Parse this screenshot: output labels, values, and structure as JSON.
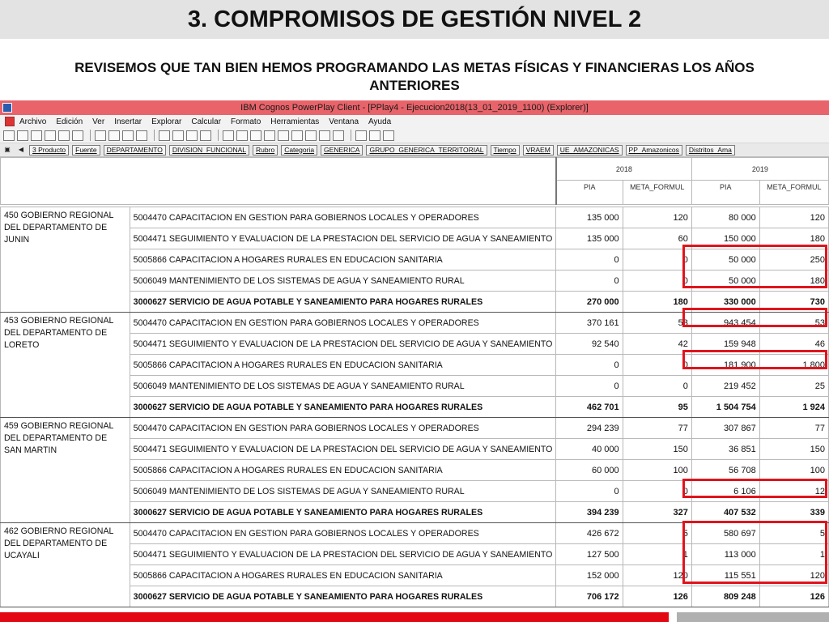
{
  "slide": {
    "title": "3. COMPROMISOS DE GESTIÓN NIVEL 2",
    "subtitle_line1": "REVISEMOS QUE TAN BIEN HEMOS PROGRAMANDO LAS METAS FÍSICAS Y FINANCIERAS LOS AÑOS",
    "subtitle_line2": "ANTERIORES"
  },
  "window": {
    "title": "IBM Cognos PowerPlay Client - [PPlay4 - Ejecucion2018(13_01_2019_1100) (Explorer)]",
    "menu": [
      "Archivo",
      "Edición",
      "Ver",
      "Insertar",
      "Explorar",
      "Calcular",
      "Formato",
      "Herramientas",
      "Ventana",
      "Ayuda"
    ],
    "dimensions": [
      "3 Producto",
      "Fuente",
      "DEPARTAMENTO",
      "DIVISION_FUNCIONAL",
      "Rubro",
      "Categoria",
      "GENERICA",
      "GRUPO_GENERICA_TERRITORIAL",
      "Tiempo",
      "VRAEM",
      "UE_AMAZONICAS",
      "PP_Amazonicos",
      "Distritos_Ama"
    ]
  },
  "table": {
    "years": [
      "2018",
      "2019"
    ],
    "columns": [
      "PIA",
      "META_FORMUL",
      "PIA",
      "META_FORMUL"
    ],
    "groups": [
      {
        "region": "450 GOBIERNO REGIONAL DEL DEPARTAMENTO DE JUNIN",
        "rows": [
          {
            "label": "5004470 CAPACITACION EN GESTION PARA GOBIERNOS LOCALES Y OPERADORES",
            "v": [
              "135 000",
              "120",
              "80 000",
              "120"
            ]
          },
          {
            "label": "5004471 SEGUIMIENTO Y EVALUACION DE LA PRESTACION DEL SERVICIO DE AGUA Y SANEAMIENTO",
            "v": [
              "135 000",
              "60",
              "150 000",
              "180"
            ]
          },
          {
            "label": "5005866 CAPACITACION A HOGARES RURALES EN EDUCACION SANITARIA",
            "v": [
              "0",
              "0",
              "50 000",
              "250"
            ]
          },
          {
            "label": "5006049 MANTENIMIENTO DE LOS SISTEMAS DE AGUA Y SANEAMIENTO RURAL",
            "v": [
              "0",
              "0",
              "50 000",
              "180"
            ]
          }
        ],
        "total": {
          "label": "3000627 SERVICIO DE AGUA POTABLE Y SANEAMIENTO PARA HOGARES RURALES",
          "v": [
            "270 000",
            "180",
            "330 000",
            "730"
          ]
        }
      },
      {
        "region": "453 GOBIERNO REGIONAL DEL DEPARTAMENTO DE LORETO",
        "rows": [
          {
            "label": "5004470 CAPACITACION EN GESTION PARA GOBIERNOS LOCALES Y OPERADORES",
            "v": [
              "370 161",
              "53",
              "943 454",
              "53"
            ]
          },
          {
            "label": "5004471 SEGUIMIENTO Y EVALUACION DE LA PRESTACION DEL SERVICIO DE AGUA Y SANEAMIENTO",
            "v": [
              "92 540",
              "42",
              "159 948",
              "46"
            ]
          },
          {
            "label": "5005866 CAPACITACION A HOGARES RURALES EN EDUCACION SANITARIA",
            "v": [
              "0",
              "0",
              "181 900",
              "1 800"
            ]
          },
          {
            "label": "5006049 MANTENIMIENTO DE LOS SISTEMAS DE AGUA Y SANEAMIENTO RURAL",
            "v": [
              "0",
              "0",
              "219 452",
              "25"
            ]
          }
        ],
        "total": {
          "label": "3000627 SERVICIO DE AGUA POTABLE Y SANEAMIENTO PARA HOGARES RURALES",
          "v": [
            "462 701",
            "95",
            "1 504 754",
            "1 924"
          ]
        }
      },
      {
        "region": "459 GOBIERNO REGIONAL DEL DEPARTAMENTO DE SAN MARTIN",
        "rows": [
          {
            "label": "5004470 CAPACITACION EN GESTION PARA GOBIERNOS LOCALES Y OPERADORES",
            "v": [
              "294 239",
              "77",
              "307 867",
              "77"
            ]
          },
          {
            "label": "5004471 SEGUIMIENTO Y EVALUACION DE LA PRESTACION DEL SERVICIO DE AGUA Y SANEAMIENTO",
            "v": [
              "40 000",
              "150",
              "36 851",
              "150"
            ]
          },
          {
            "label": "5005866 CAPACITACION A HOGARES RURALES EN EDUCACION SANITARIA",
            "v": [
              "60 000",
              "100",
              "56 708",
              "100"
            ]
          },
          {
            "label": "5006049 MANTENIMIENTO DE LOS SISTEMAS DE AGUA Y SANEAMIENTO RURAL",
            "v": [
              "0",
              "0",
              "6 106",
              "12"
            ]
          }
        ],
        "total": {
          "label": "3000627 SERVICIO DE AGUA POTABLE Y SANEAMIENTO PARA HOGARES RURALES",
          "v": [
            "394 239",
            "327",
            "407 532",
            "339"
          ]
        }
      },
      {
        "region": "462 GOBIERNO REGIONAL DEL DEPARTAMENTO DE UCAYALI",
        "rows": [
          {
            "label": "5004470 CAPACITACION EN GESTION PARA GOBIERNOS LOCALES Y OPERADORES",
            "v": [
              "426 672",
              "5",
              "580 697",
              "5"
            ]
          },
          {
            "label": "5004471 SEGUIMIENTO Y EVALUACION DE LA PRESTACION DEL SERVICIO DE AGUA Y SANEAMIENTO",
            "v": [
              "127 500",
              "1",
              "113 000",
              "1"
            ]
          },
          {
            "label": "5005866 CAPACITACION A HOGARES RURALES EN EDUCACION SANITARIA",
            "v": [
              "152 000",
              "120",
              "115 551",
              "120"
            ]
          }
        ],
        "total": {
          "label": "3000627 SERVICIO DE AGUA POTABLE Y SANEAMIENTO PARA HOGARES RURALES",
          "v": [
            "706 172",
            "126",
            "809 248",
            "126"
          ]
        }
      }
    ]
  },
  "colors": {
    "highlight": "#e0141c",
    "window_title_bar": "#e8646a",
    "footer_red": "#e30613"
  }
}
